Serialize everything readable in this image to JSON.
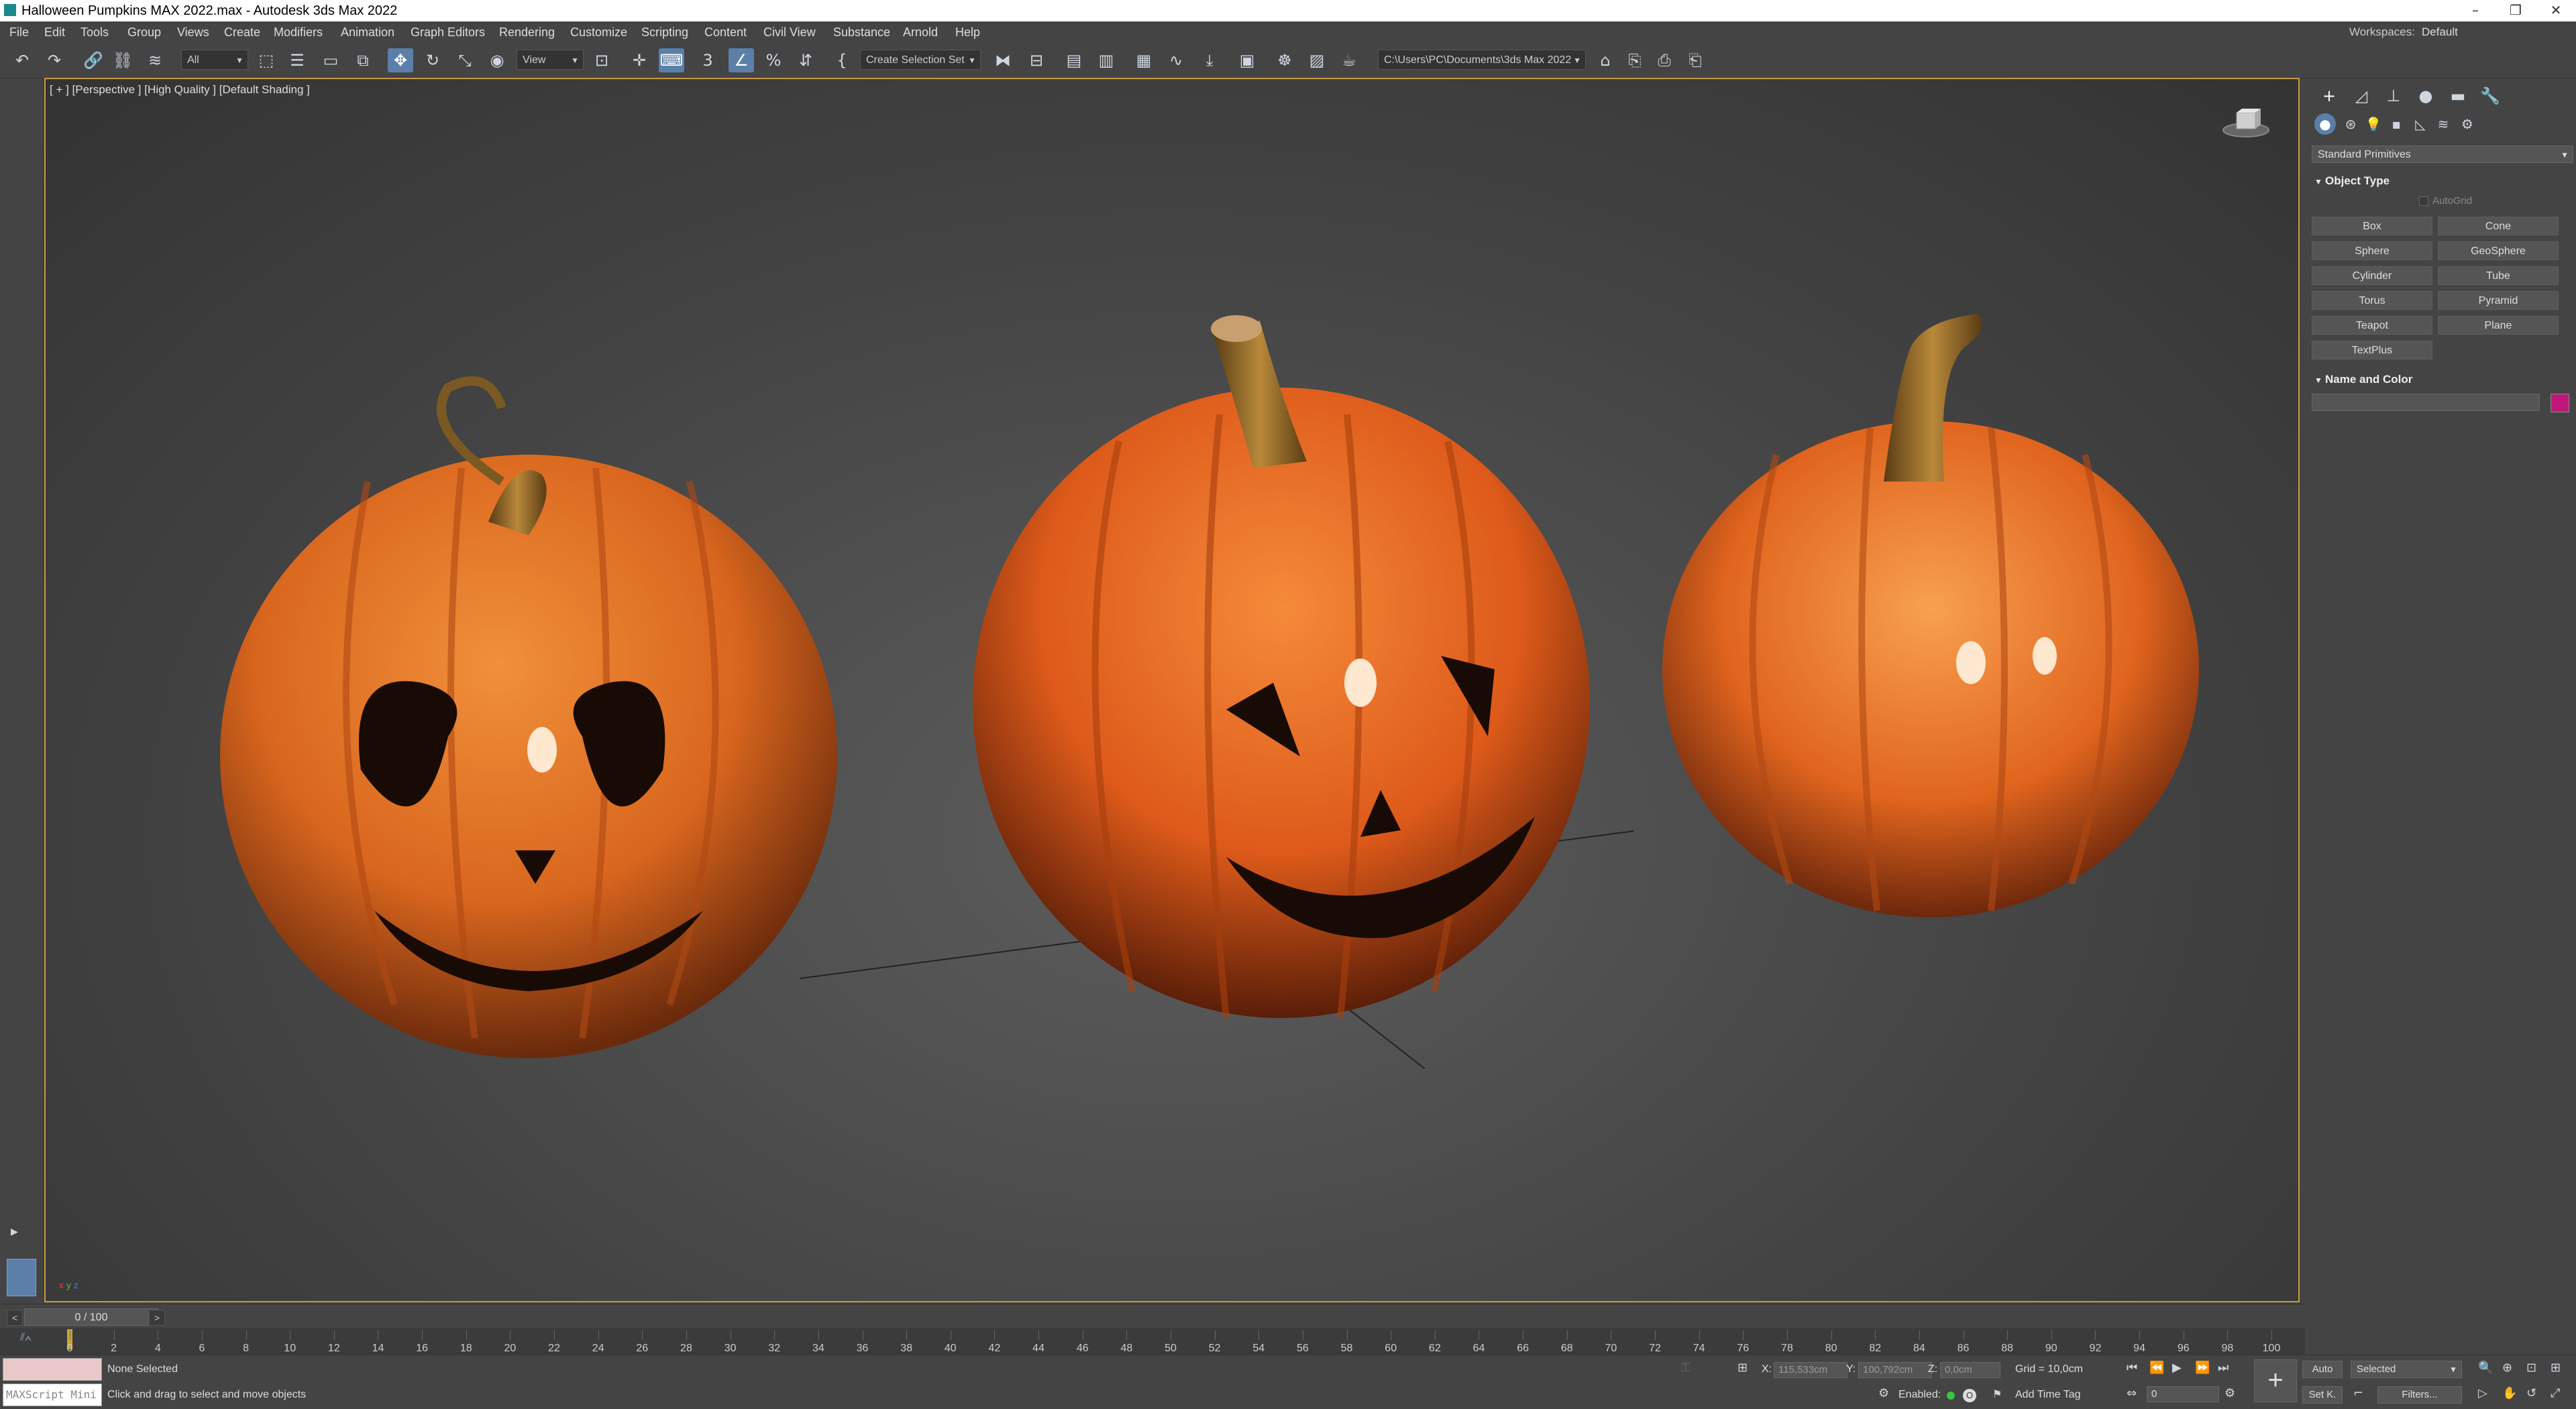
{
  "window": {
    "title": "Halloween Pumpkins MAX 2022.max - Autodesk 3ds Max 2022",
    "minimize": "–",
    "restore": "❐",
    "close": "✕"
  },
  "menu": {
    "items": [
      "File",
      "Edit",
      "Tools",
      "Group",
      "Views",
      "Create",
      "Modifiers",
      "Animation",
      "Graph Editors",
      "Rendering",
      "Customize",
      "Scripting",
      "Content",
      "Civil View",
      "Substance",
      "Arnold",
      "Help"
    ],
    "workspaces_label": "Workspaces:",
    "workspaces_value": "Default"
  },
  "toolbar": {
    "selection_filter": "All",
    "ref_coord": "View",
    "named_selection": "Create Selection Set",
    "path": "C:\\Users\\PC\\Documents\\3ds Max 2022"
  },
  "viewport": {
    "label": "[ + ] [Perspective ] [High Quality ] [Default Shading ]",
    "axis_x": "x",
    "axis_y": "y",
    "axis_z": "z",
    "colors": {
      "border": "#c89a3c",
      "pumpkin": "#d9661e",
      "stem": "#7a5a22"
    }
  },
  "command_panel": {
    "category_dropdown": "Standard Primitives",
    "object_type": {
      "title": "Object Type",
      "autogrid": "AutoGrid",
      "buttons": [
        "Box",
        "Cone",
        "Sphere",
        "GeoSphere",
        "Cylinder",
        "Tube",
        "Torus",
        "Pyramid",
        "Teapot",
        "Plane",
        "TextPlus"
      ]
    },
    "name_color": {
      "title": "Name and Color",
      "name_value": "",
      "color": "#c0187a"
    }
  },
  "time": {
    "frame_display": "0 / 100",
    "prev": "<",
    "next": ">",
    "ticks": [
      "0",
      "2",
      "4",
      "6",
      "8",
      "10",
      "12",
      "14",
      "16",
      "18",
      "20",
      "22",
      "24",
      "26",
      "28",
      "30",
      "32",
      "34",
      "36",
      "38",
      "40",
      "42",
      "44",
      "46",
      "48",
      "50",
      "52",
      "54",
      "56",
      "58",
      "60",
      "62",
      "64",
      "66",
      "68",
      "70",
      "72",
      "74",
      "76",
      "78",
      "80",
      "82",
      "84",
      "86",
      "88",
      "90",
      "92",
      "94",
      "96",
      "98",
      "100"
    ]
  },
  "status": {
    "maxscript": "MAXScript Mini",
    "selection": "None Selected",
    "prompt": "Click and drag to select and move objects",
    "x_label": "X:",
    "x_value": "115,533cm",
    "y_label": "Y:",
    "y_value": "100,792cm",
    "z_label": "Z:",
    "z_value": "0,0cm",
    "grid": "Grid = 10,0cm",
    "enabled_label": "Enabled:",
    "add_time_tag": "Add Time Tag",
    "auto": "Auto",
    "set_key": "Set K.",
    "key_filter": "Selected",
    "filters": "Filters...",
    "frame_field": "0"
  }
}
